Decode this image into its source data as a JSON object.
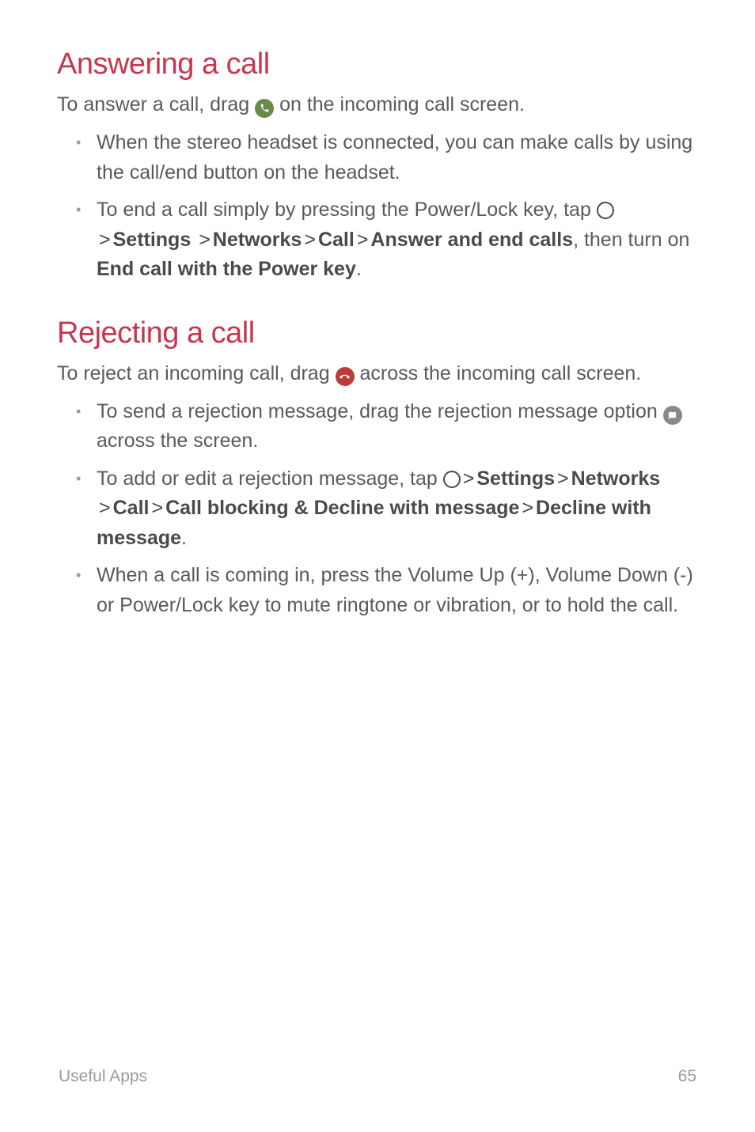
{
  "section1": {
    "heading": "Answering a call",
    "intro_pre": "To answer a call, drag ",
    "intro_post": " on the incoming call screen.",
    "bullet1": "When the stereo headset is connected, you can make calls by using the call/end button on the headset.",
    "bullet2_pre": "To end a call simply by pressing the Power/Lock key, tap ",
    "bullet2_b1": "Settings",
    "bullet2_b2": "Networks",
    "bullet2_b3": "Call",
    "bullet2_b4": "Answer and end calls",
    "bullet2_mid": ", then turn on ",
    "bullet2_b5": "End call with the Power key",
    "bullet2_end": "."
  },
  "section2": {
    "heading": "Rejecting a call",
    "intro_pre": "To reject an incoming call, drag ",
    "intro_post": " across the incoming call screen.",
    "bullet1_pre": "To send a rejection message, drag the rejection message option ",
    "bullet1_post": " across the screen.",
    "bullet2_pre": "To add or edit a rejection message, tap ",
    "bullet2_b1": "Settings",
    "bullet2_b2": "Networks",
    "bullet2_b3": "Call",
    "bullet2_b4": "Call blocking & Decline with message",
    "bullet2_b5": "Decline with message",
    "bullet2_end": ".",
    "bullet3": "When a call is coming in, press the Volume Up (+), Volume Down (-) or Power/Lock key to mute ringtone or vibration, or to hold the call."
  },
  "sep": ">",
  "footer": {
    "left": "Useful Apps",
    "right": "65"
  }
}
